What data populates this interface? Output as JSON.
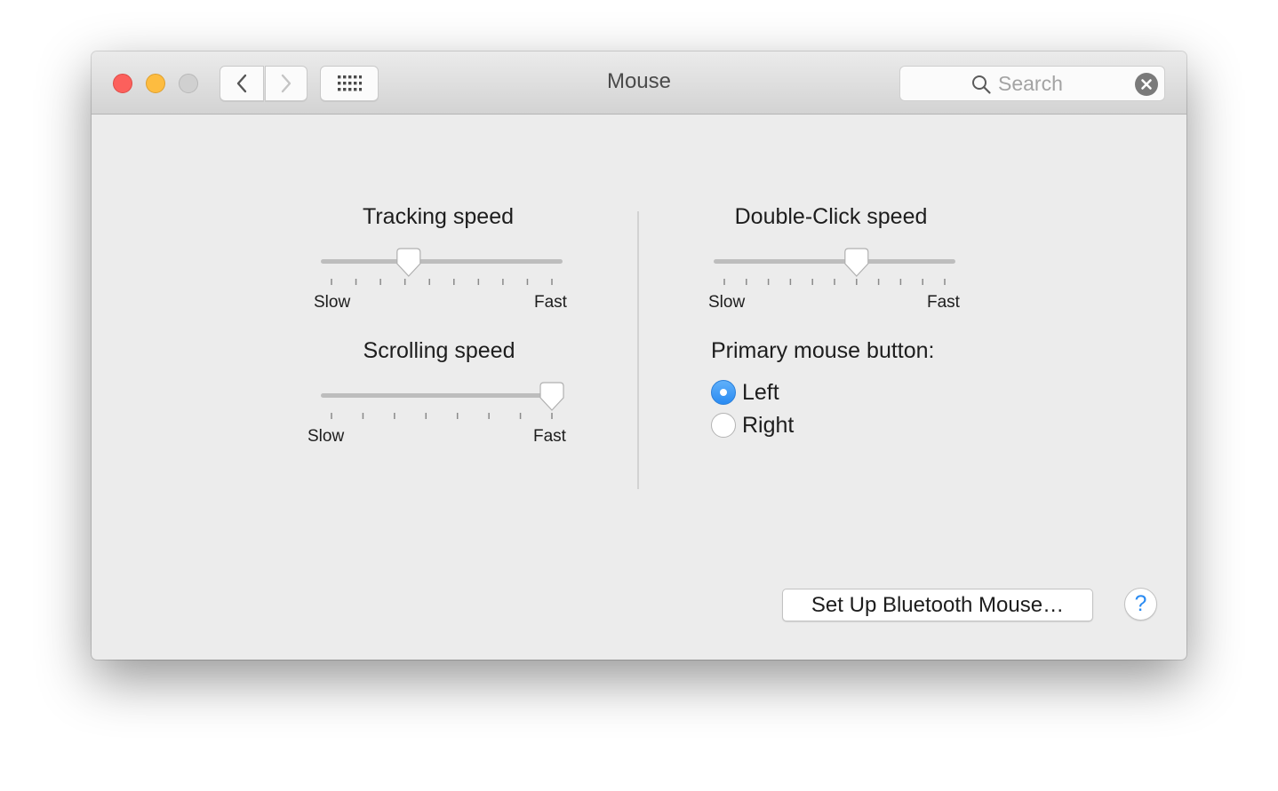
{
  "window": {
    "title": "Mouse"
  },
  "toolbar": {
    "back_icon": "chevron-left-icon",
    "forward_icon": "chevron-right-icon",
    "grid_icon": "show-all-grid-icon"
  },
  "search": {
    "placeholder": "Search",
    "value": "",
    "clear_icon": "clear-x-icon"
  },
  "tracking": {
    "label": "Tracking speed",
    "min_label": "Slow",
    "max_label": "Fast",
    "ticks": 10,
    "value": 0.35
  },
  "scrolling": {
    "label": "Scrolling speed",
    "min_label": "Slow",
    "max_label": "Fast",
    "ticks": 8,
    "value": 1.0
  },
  "double_click": {
    "label": "Double-Click speed",
    "min_label": "Slow",
    "max_label": "Fast",
    "ticks": 11,
    "value": 0.6
  },
  "primary_button": {
    "label": "Primary mouse button:",
    "options": [
      {
        "label": "Left",
        "selected": true
      },
      {
        "label": "Right",
        "selected": false
      }
    ]
  },
  "bluetooth_button": {
    "label": "Set Up Bluetooth Mouse…"
  },
  "help_button": {
    "label": "?"
  },
  "colors": {
    "close": "#fc605c",
    "minimize": "#fdbc40",
    "zoom_disabled": "#d0d0d0",
    "accent": "#2a8bf2"
  }
}
